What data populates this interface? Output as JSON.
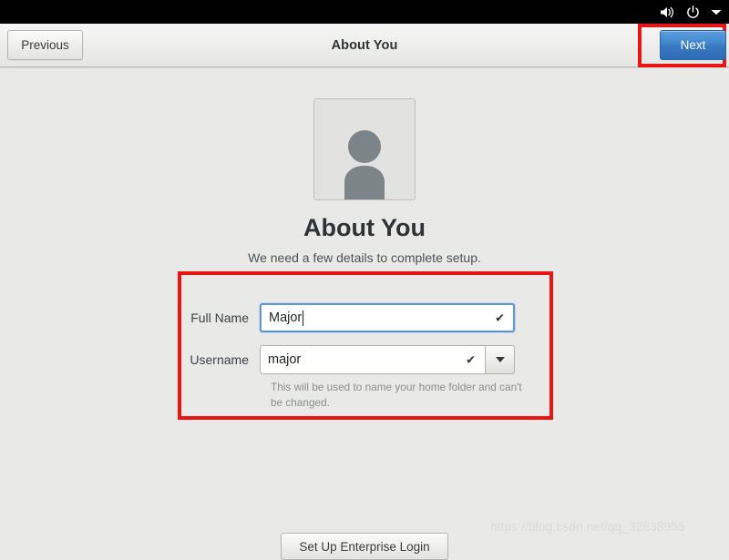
{
  "system_bar": {
    "icons": [
      {
        "name": "volume-icon",
        "label": "Volume"
      },
      {
        "name": "power-icon",
        "label": "Power"
      },
      {
        "name": "chevron-down-icon",
        "label": "System menu"
      }
    ]
  },
  "header": {
    "title": "About You",
    "previous_label": "Previous",
    "next_label": "Next",
    "next_highlight_color": "#e81515"
  },
  "content": {
    "avatar_icon": "user-avatar-icon",
    "heading": "About You",
    "subtitle": "We need a few details to complete setup.",
    "form": {
      "highlight_color": "#e81515",
      "fields": [
        {
          "label": "Full Name",
          "value": "Major",
          "valid_icon": "checkmark-icon",
          "focused": true,
          "has_dropdown": false
        },
        {
          "label": "Username",
          "value": "major",
          "valid_icon": "checkmark-icon",
          "focused": false,
          "has_dropdown": true,
          "dropdown_icon": "chevron-down-icon"
        }
      ],
      "hint": "This will be used to name your home folder and can't be changed."
    },
    "enterprise_button_label": "Set Up Enterprise Login"
  },
  "watermark": "https://blog.csdn.net/qq_32838955"
}
